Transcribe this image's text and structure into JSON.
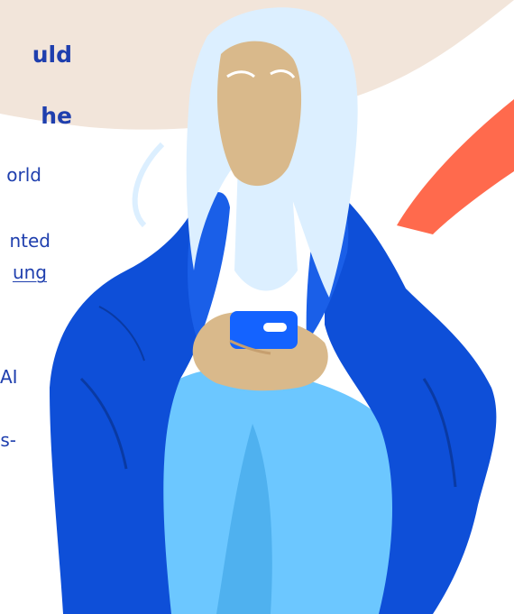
{
  "heading": {
    "line1": "uld",
    "line2": "he"
  },
  "text_fragments": [
    "orld",
    "nted",
    "ung",
    "AI",
    "s-"
  ],
  "colors": {
    "heading": "#1f3fae",
    "beige_blob": "#f2e5da",
    "orange_stroke": "#ff6a4d",
    "hair": "#dcefff",
    "skin": "#d9b98b",
    "jacket": "#0e4fd8",
    "jeans": "#6cc7ff",
    "phone": "#1463ff"
  }
}
